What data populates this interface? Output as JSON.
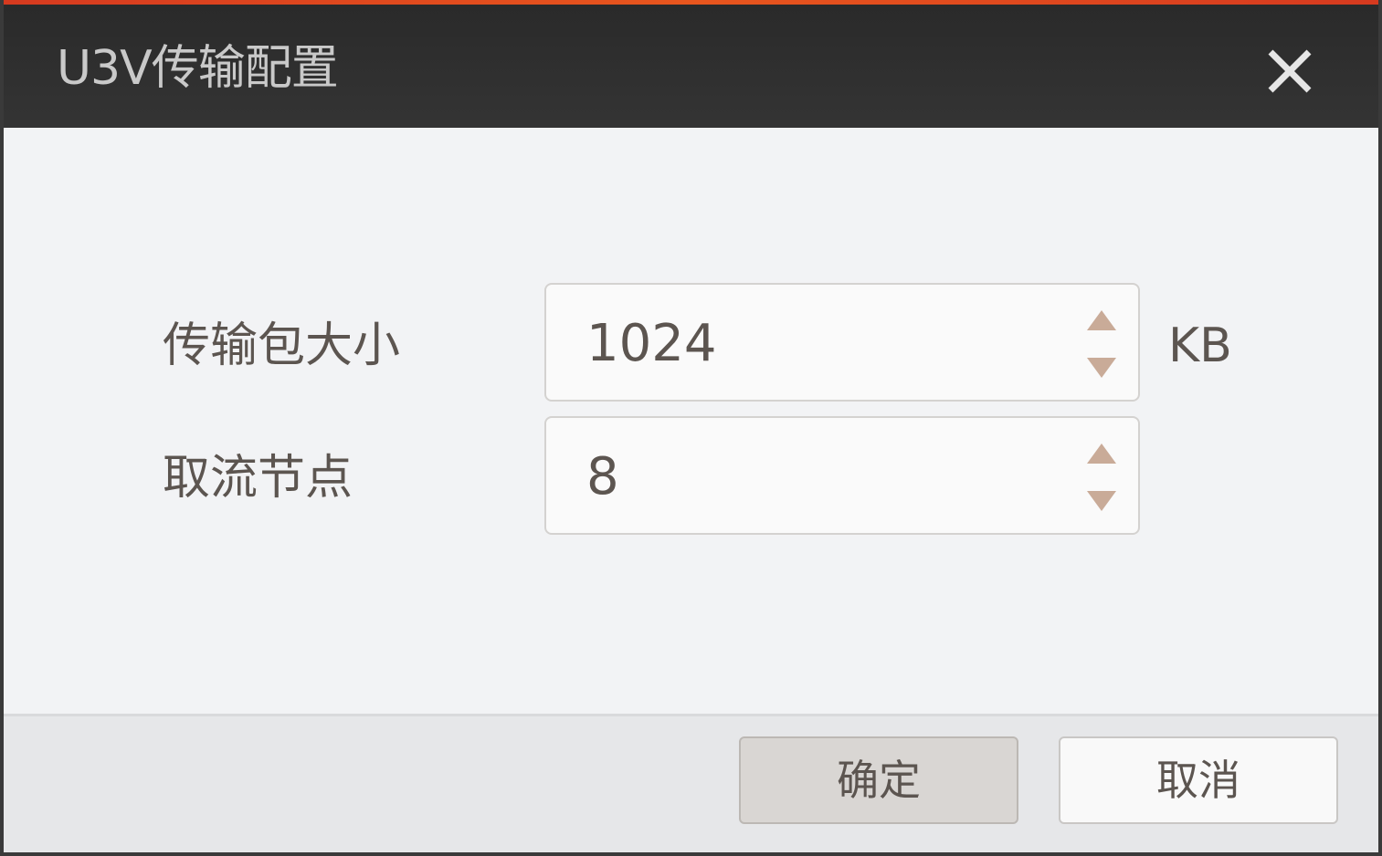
{
  "dialog": {
    "title": "U3V传输配置",
    "close_icon": "close-icon",
    "accent_color": "#e8561e"
  },
  "fields": [
    {
      "label": "传输包大小",
      "value": "1024",
      "unit": "KB"
    },
    {
      "label": "取流节点",
      "value": "8",
      "unit": ""
    }
  ],
  "buttons": {
    "ok_label": "确定",
    "cancel_label": "取消"
  },
  "colors": {
    "titlebar": "#2e2e2e",
    "body": "#f2f3f5",
    "footer": "#e6e7e9",
    "text": "#5c5550",
    "spin_arrow": "#c9ab98"
  }
}
